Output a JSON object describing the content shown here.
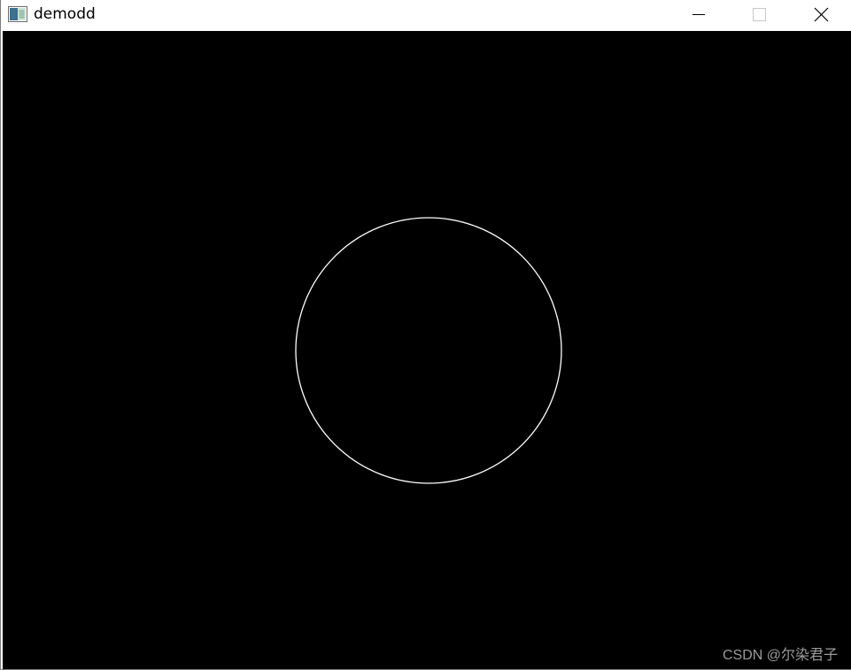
{
  "window": {
    "title": "demodd",
    "controls": {
      "minimize_icon": "minimize-icon",
      "maximize_icon": "maximize-icon",
      "close_icon": "close-icon"
    }
  },
  "canvas": {
    "background_color": "#000000",
    "shape": "circle",
    "stroke_color": "#ffffff"
  },
  "watermark": {
    "text": "CSDN @尔染君子"
  }
}
